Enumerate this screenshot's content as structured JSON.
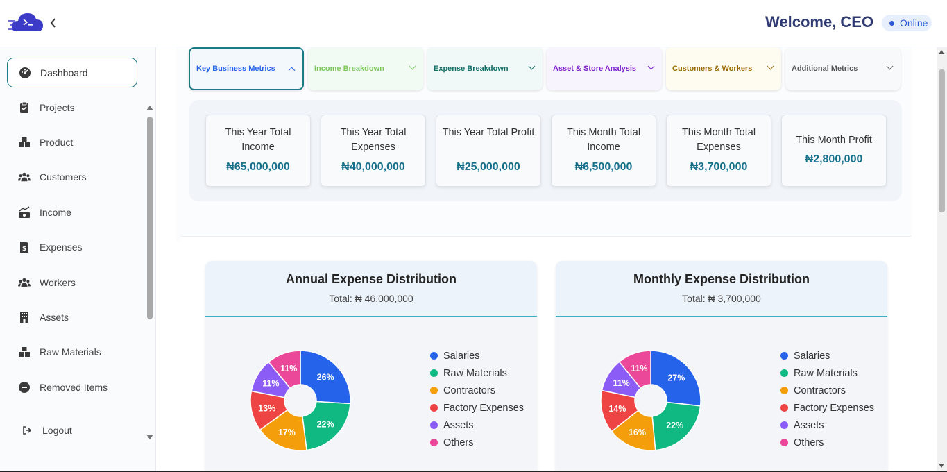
{
  "header": {
    "welcome": "Welcome, CEO",
    "status": "Online",
    "logo_icon": "cloud-terminal-logo",
    "back_icon": "chevron-left-icon"
  },
  "sidebar": {
    "items": [
      {
        "label": "Dashboard",
        "icon": "dashboard-gauge-icon",
        "active": true
      },
      {
        "label": "Projects",
        "icon": "clipboard-check-icon"
      },
      {
        "label": "Product",
        "icon": "boxes-icon"
      },
      {
        "label": "Customers",
        "icon": "users-icon"
      },
      {
        "label": "Income",
        "icon": "money-chart-icon"
      },
      {
        "label": "Expenses",
        "icon": "invoice-dollar-icon"
      },
      {
        "label": "Workers",
        "icon": "workers-icon"
      },
      {
        "label": "Assets",
        "icon": "building-icon"
      },
      {
        "label": "Raw Materials",
        "icon": "boxes-icon"
      },
      {
        "label": "Removed Items",
        "icon": "minus-circle-icon"
      }
    ],
    "logout": "Logout"
  },
  "tabs": [
    {
      "label": "Key Business Metrics",
      "color": "#2563eb",
      "bg": "#f3f8fd",
      "active": true
    },
    {
      "label": "Income Breakdown",
      "color": "#7cc85a",
      "bg": "#f1fbf3"
    },
    {
      "label": "Expense Breakdown",
      "color": "#12706a",
      "bg": "#f0f9f8"
    },
    {
      "label": "Asset & Store Analysis",
      "color": "#7e22ce",
      "bg": "#f8f4fd"
    },
    {
      "label": "Customers & Workers",
      "color": "#9a6a00",
      "bg": "#fefcf0"
    },
    {
      "label": "Additional Metrics",
      "color": "#555555",
      "bg": "#f8f9fa"
    }
  ],
  "metrics": [
    {
      "label": "This Year Total Income",
      "value": "₦65,000,000"
    },
    {
      "label": "This Year Total Expenses",
      "value": "₦40,000,000"
    },
    {
      "label": "This Year Total Profit",
      "value": "₦25,000,000"
    },
    {
      "label": "This Month Total Income",
      "value": "₦6,500,000"
    },
    {
      "label": "This Month Total Expenses",
      "value": "₦3,700,000"
    },
    {
      "label": "This Month Profit",
      "value": "₦2,800,000"
    }
  ],
  "chart_data": [
    {
      "type": "pie",
      "title": "Annual Expense Distribution",
      "subtitle": "Total: ₦ 46,000,000",
      "categories": [
        "Salaries",
        "Raw Materials",
        "Contractors",
        "Factory Expenses",
        "Assets",
        "Others"
      ],
      "values": [
        26,
        22,
        17,
        13,
        11,
        11
      ],
      "data_labels": [
        "26%",
        "22%",
        "17%",
        "13%",
        "11%",
        "11%"
      ],
      "colors": [
        "#2563eb",
        "#10b981",
        "#f59e0b",
        "#ef4444",
        "#8b5cf6",
        "#ec4899"
      ],
      "legend": "right"
    },
    {
      "type": "pie",
      "title": "Monthly Expense Distribution",
      "subtitle": "Total: ₦ 3,700,000",
      "categories": [
        "Salaries",
        "Raw Materials",
        "Contractors",
        "Factory Expenses",
        "Assets",
        "Others"
      ],
      "values": [
        27,
        22,
        16,
        14,
        11,
        11
      ],
      "data_labels": [
        "27%",
        "22%",
        "16%",
        "14%",
        "11%",
        "11%"
      ],
      "colors": [
        "#2563eb",
        "#10b981",
        "#f59e0b",
        "#ef4444",
        "#8b5cf6",
        "#ec4899"
      ],
      "legend": "right"
    }
  ]
}
